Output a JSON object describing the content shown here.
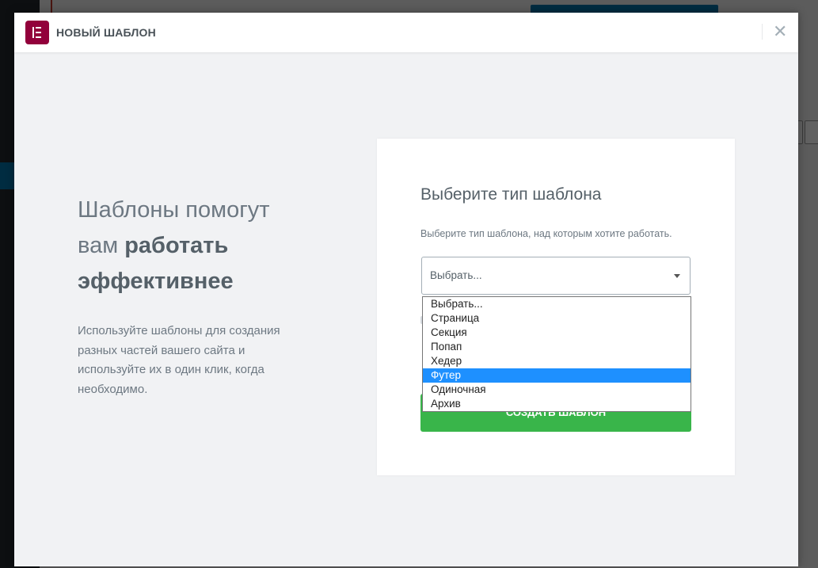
{
  "modal": {
    "title": "НОВЫЙ ШАБЛОН",
    "close_symbol": "✕",
    "logo_icon": "elementor-logo-icon",
    "logo_color": "#92003b"
  },
  "intro": {
    "heading_plain": "Шаблоны помогут вам",
    "heading_bold": "работать эффективнее",
    "text": "Используйте шаблоны для создания разных частей вашего сайта и используйте их в один клик, когда необходимо."
  },
  "form": {
    "title": "Выберите тип шаблона",
    "label": "Выберите тип шаблона, над которым хотите работать.",
    "select_value": "Выбрать...",
    "options": [
      "Выбрать...",
      "Страница",
      "Секция",
      "Попап",
      "Хедер",
      "Футер",
      "Одиночная",
      "Архив"
    ],
    "highlighted_option": "Футер",
    "submit_label": "Создать шаблон",
    "submit_color": "#39b54a",
    "highlight_color": "#1e90ff"
  }
}
